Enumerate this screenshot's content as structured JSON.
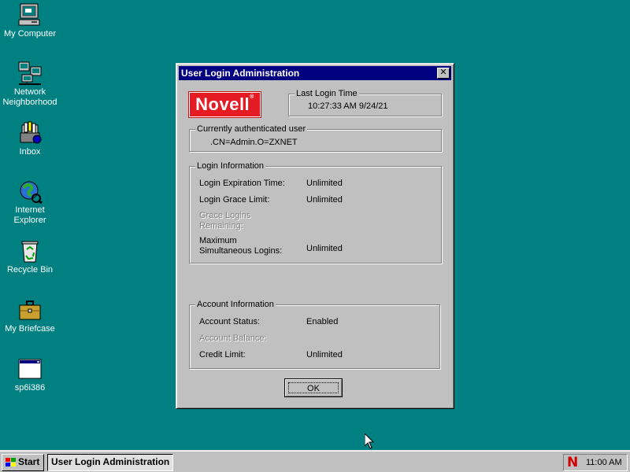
{
  "desktop": {
    "icons": [
      {
        "label": "My Computer",
        "icon": "computer-icon"
      },
      {
        "label": "Network Neighborhood",
        "icon": "network-icon"
      },
      {
        "label": "Inbox",
        "icon": "inbox-icon"
      },
      {
        "label": "Internet Explorer",
        "icon": "internet-explorer-icon"
      },
      {
        "label": "Recycle Bin",
        "icon": "recycle-bin-icon"
      },
      {
        "label": "My Briefcase",
        "icon": "briefcase-icon"
      },
      {
        "label": "sp6i386",
        "icon": "program-window-icon"
      }
    ]
  },
  "dialog": {
    "title": "User Login Administration",
    "close_glyph": "✕",
    "logo_text": "Novell",
    "logo_mark": "®",
    "last_login": {
      "legend": "Last Login Time",
      "value": "10:27:33 AM 9/24/21"
    },
    "current_user": {
      "legend": "Currently authenticated user",
      "value": ".CN=Admin.O=ZXNET"
    },
    "login_info": {
      "legend": "Login Information",
      "expiration_label": "Login Expiration Time:",
      "expiration_value": "Unlimited",
      "grace_limit_label": "Login Grace Limit:",
      "grace_limit_value": "Unlimited",
      "grace_remaining_label_1": "Grace Logins",
      "grace_remaining_label_2": "Remaining:",
      "max_sim_label_1": "Maximum",
      "max_sim_label_2": "Simultaneous Logins:",
      "max_sim_value": "Unlimited"
    },
    "account_info": {
      "legend": "Account Information",
      "status_label": "Account Status:",
      "status_value": "Enabled",
      "balance_label": "Account Balance:",
      "credit_label": "Credit Limit:",
      "credit_value": "Unlimited"
    },
    "ok_label": "OK"
  },
  "taskbar": {
    "start_label": "Start",
    "task_label": "User Login Administration",
    "tray_glyph": "N",
    "clock": "11:00 AM"
  },
  "colors": {
    "desktop": "#008080",
    "titlebar": "#000080",
    "novell_red": "#e41b23",
    "tray_n": "#d00000"
  }
}
